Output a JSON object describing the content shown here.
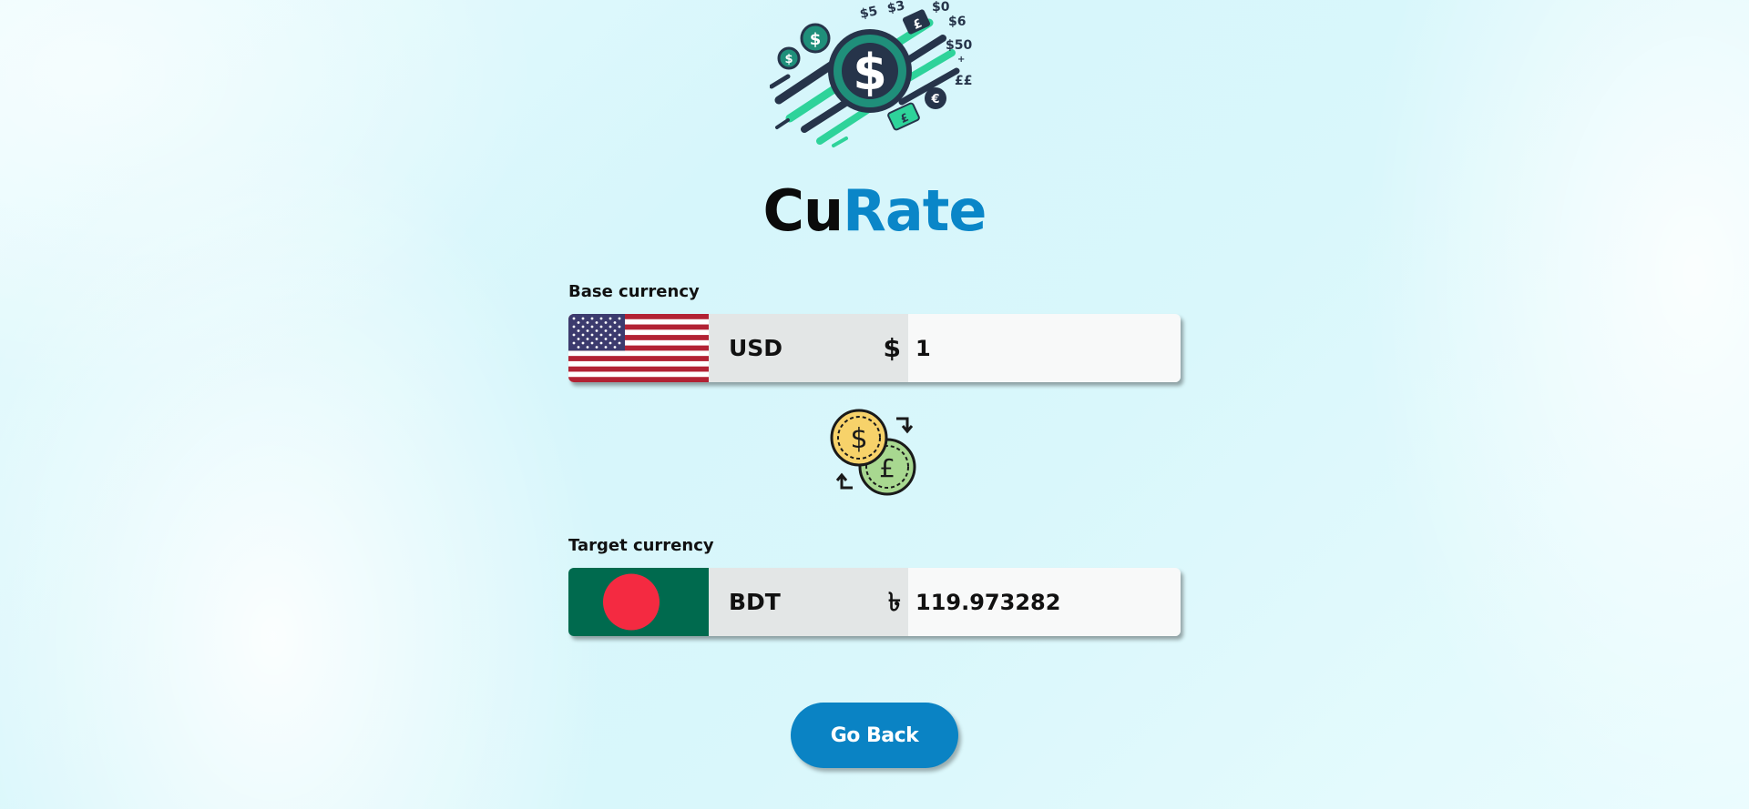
{
  "brand": {
    "part1": "Cu",
    "part2": "Rate"
  },
  "base": {
    "label": "Base currency",
    "flag": "us-flag",
    "code": "USD",
    "symbol": "$",
    "amount": "1"
  },
  "target": {
    "label": "Target currency",
    "flag": "bangladesh-flag",
    "code": "BDT",
    "symbol": "৳",
    "amount": "119.973282"
  },
  "logo": {
    "icon": "money-logo-icon",
    "price_tags": [
      "$5",
      "$3",
      "$0",
      "$6",
      "$50",
      "££",
      "£"
    ]
  },
  "swap_icon": {
    "icon": "currency-exchange-icon",
    "symbols": [
      "$",
      "£"
    ]
  },
  "actions": {
    "go_back_label": "Go Back"
  },
  "colors": {
    "accent": "#0a86c8",
    "button": "#0a83c4",
    "code_bg": "#e3e6e6",
    "input_bg": "#f8f9f9",
    "bd_green": "#006a4e",
    "bd_red": "#f42a41",
    "us_red": "#b22234",
    "us_blue": "#3c3b6e"
  }
}
